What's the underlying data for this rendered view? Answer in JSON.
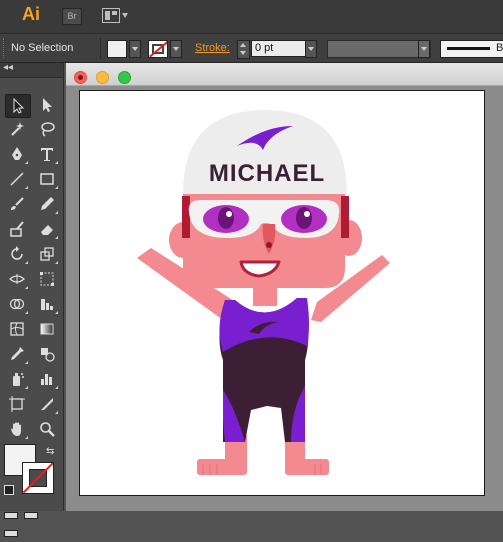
{
  "app": {
    "logo": "Ai",
    "bridge_label": "Br"
  },
  "control_bar": {
    "selection_status": "No Selection",
    "stroke_label": "Stroke:",
    "stroke_weight": "0 pt",
    "brush_char": "B"
  },
  "artwork": {
    "cap_text": "MICHAEL"
  },
  "colors": {
    "accent": "#f7a21b",
    "skin": "#f28a8f",
    "cap": "#ededed",
    "purple": "#7a1fd0",
    "dark_suit": "#3c1f35"
  },
  "icons": [
    "selection-icon",
    "direct-selection-icon",
    "magic-wand-icon",
    "lasso-icon",
    "pen-icon",
    "type-icon",
    "line-segment-icon",
    "rectangle-icon",
    "paintbrush-icon",
    "pencil-icon",
    "blob-brush-icon",
    "eraser-icon",
    "rotate-icon",
    "scale-icon",
    "width-icon",
    "free-transform-icon",
    "shape-builder-icon",
    "perspective-grid-icon",
    "mesh-icon",
    "gradient-icon",
    "eyedropper-icon",
    "blend-icon",
    "symbol-sprayer-icon",
    "column-graph-icon",
    "artboard-icon",
    "slice-icon",
    "hand-icon",
    "zoom-icon"
  ]
}
